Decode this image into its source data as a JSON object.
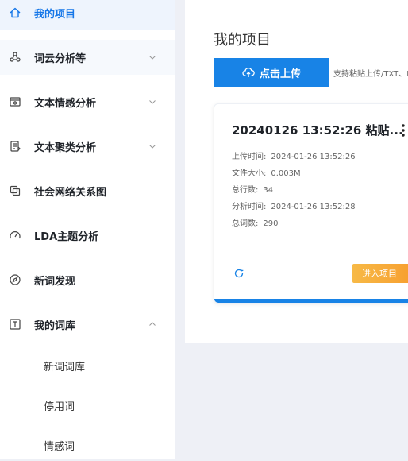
{
  "colors": {
    "accent": "#1883e6",
    "active_bg": "#eef4fd",
    "orange": "#f79a2b"
  },
  "sidebar": {
    "items": [
      {
        "label": "我的项目",
        "icon": "home-icon"
      },
      {
        "label": "词云分析等",
        "icon": "network-icon"
      },
      {
        "label": "文本情感分析",
        "icon": "emotion-icon"
      },
      {
        "label": "文本聚类分析",
        "icon": "document-icon"
      },
      {
        "label": "社会网络关系图",
        "icon": "copy-icon"
      },
      {
        "label": "LDA主题分析",
        "icon": "gauge-icon"
      },
      {
        "label": "新词发现",
        "icon": "compass-icon"
      },
      {
        "label": "我的词库",
        "icon": "text-icon"
      }
    ],
    "subitems": [
      "新词词库",
      "停用词",
      "情感词"
    ]
  },
  "main": {
    "title": "我的项目",
    "upload_label": "点击上传",
    "upload_hint": "支持粘贴上传/TXT、D",
    "card": {
      "title": "20240126 13:52:26 粘贴...",
      "meta": [
        {
          "key": "上传时间:",
          "value": "2024-01-26 13:52:26"
        },
        {
          "key": "文件大小:",
          "value": "0.003M"
        },
        {
          "key": "总行数:",
          "value": "34"
        },
        {
          "key": "分析时间:",
          "value": "2024-01-26 13:52:28"
        },
        {
          "key": "总词数:",
          "value": "290"
        }
      ],
      "enter_label": "进入项目"
    }
  }
}
